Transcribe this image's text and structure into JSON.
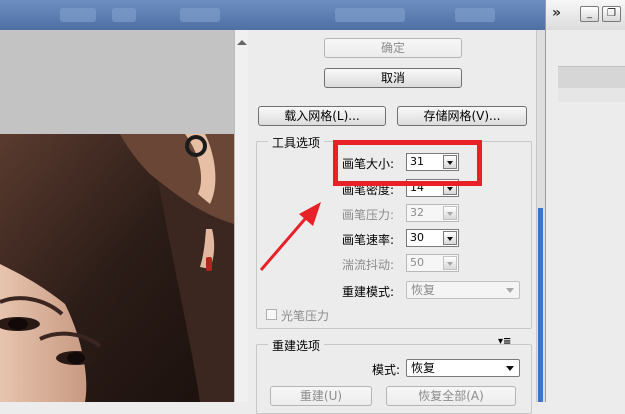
{
  "window_controls": {
    "collapse": "»",
    "minimize": "_",
    "restore": "❐"
  },
  "buttons": {
    "ok": "确定",
    "cancel": "取消",
    "load_mesh": "载入网格(L)...",
    "save_mesh": "存储网格(V)..."
  },
  "tool_options": {
    "title": "工具选项",
    "fields": [
      {
        "label": "画笔大小:",
        "value": "31",
        "enabled": true
      },
      {
        "label": "画笔密度:",
        "value": "14",
        "enabled": true
      },
      {
        "label": "画笔压力:",
        "value": "32",
        "enabled": false
      },
      {
        "label": "画笔速率:",
        "value": "30",
        "enabled": true
      },
      {
        "label": "湍流抖动:",
        "value": "50",
        "enabled": false
      }
    ],
    "reconstruct_mode": {
      "label": "重建模式:",
      "value": "恢复",
      "enabled": false
    },
    "stylus_pressure": {
      "label": "光笔压力",
      "checked": false,
      "enabled": false
    }
  },
  "reconstruct_options": {
    "title": "重建选项",
    "mode": {
      "label": "模式:",
      "value": "恢复"
    },
    "reconstruct_button": "重建(U)",
    "restore_all_button": "恢复全部(A)"
  },
  "colors": {
    "annotation": "#e82128",
    "scroll_accent": "#3f73c8"
  }
}
